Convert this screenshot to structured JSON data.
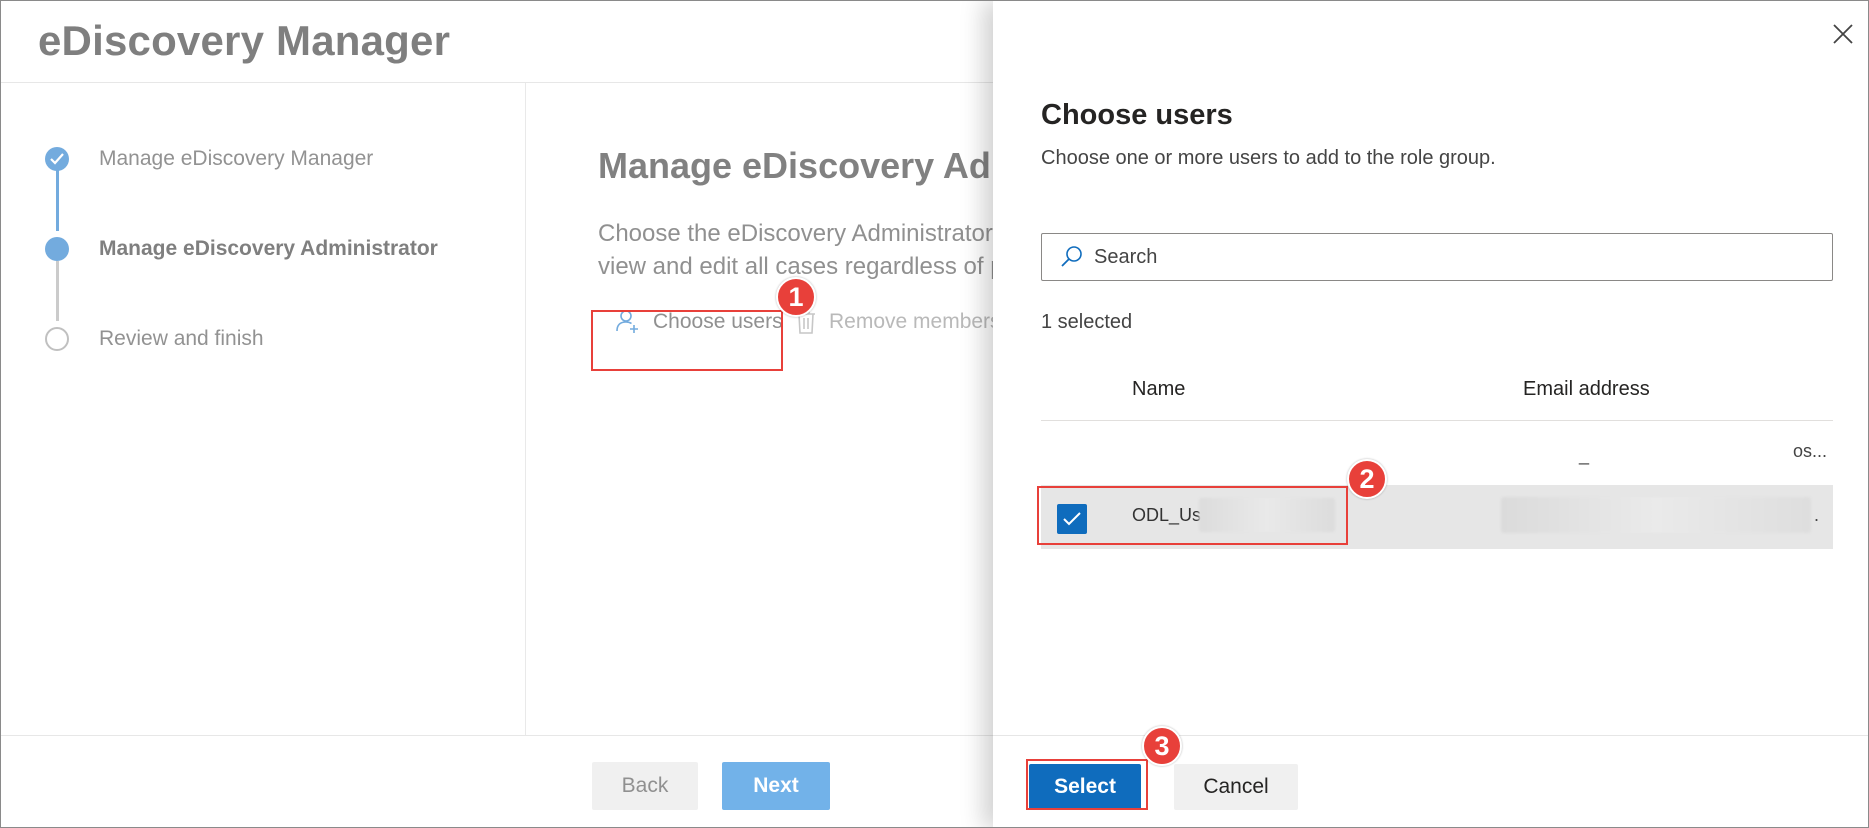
{
  "wizard": {
    "title": "eDiscovery Manager",
    "steps": [
      {
        "label": "Manage eDiscovery Manager",
        "state": "done"
      },
      {
        "label": "Manage eDiscovery Administrator",
        "state": "current"
      },
      {
        "label": "Review and finish",
        "state": "todo"
      }
    ],
    "main_title": "Manage eDiscovery Adr",
    "description_line1": "Choose the eDiscovery Administrator",
    "description_line2": "view and edit all cases regardless of p",
    "choose_users_label": "Choose users",
    "remove_members_label": "Remove members",
    "back_label": "Back",
    "next_label": "Next"
  },
  "panel": {
    "title": "Choose users",
    "description": "Choose one or more users to add to the role group.",
    "search_placeholder": "Search",
    "selected_count": "1 selected",
    "columns": {
      "name": "Name",
      "email": "Email address"
    },
    "rows": [
      {
        "name": "",
        "email_part_a": "_",
        "email_part_b": "os...",
        "checked": false
      },
      {
        "name": "ODL_Use",
        "email_suffix": ".",
        "checked": true
      }
    ],
    "select_label": "Select",
    "cancel_label": "Cancel"
  },
  "annotations": {
    "badge1": "1",
    "badge2": "2",
    "badge3": "3"
  },
  "colors": {
    "accent": "#0f6cbd",
    "callout": "#e8403a",
    "step_blue": "#6ba6dc"
  }
}
